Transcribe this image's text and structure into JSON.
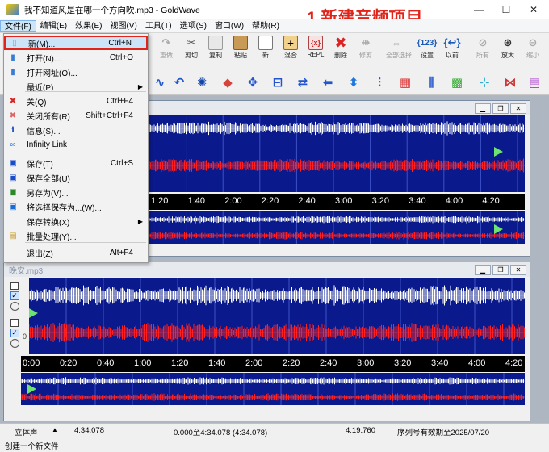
{
  "window": {
    "title": "我不知道风是在哪一个方向吹.mp3 - GoldWave"
  },
  "menu": [
    "文件(F)",
    "编辑(E)",
    "效果(E)",
    "视图(V)",
    "工具(T)",
    "选项(S)",
    "窗口(W)",
    "帮助(R)"
  ],
  "toolbar_labels": [
    "重做",
    "剪切",
    "复制",
    "粘贴",
    "新",
    "混合",
    "REPL",
    "删除",
    "修剪",
    "全部选择",
    "设置",
    "以前",
    "所有",
    "放大",
    "缩小"
  ],
  "file_menu": [
    {
      "icon": "new-file-icon",
      "label": "新(M)...",
      "shortcut": "Ctrl+N"
    },
    {
      "icon": "open-folder-icon",
      "label": "打开(N)...",
      "shortcut": "Ctrl+O"
    },
    {
      "icon": "open-url-icon",
      "label": "打开网址(O)...",
      "shortcut": ""
    },
    {
      "icon": "",
      "label": "最近(P)",
      "shortcut": ""
    },
    {
      "icon": "close-x-icon",
      "label": "关(Q)",
      "shortcut": "Ctrl+F4"
    },
    {
      "icon": "close-all-icon",
      "label": "关闭所有(R)",
      "shortcut": "Shift+Ctrl+F4"
    },
    {
      "icon": "info-icon",
      "label": "信息(S)...",
      "shortcut": ""
    },
    {
      "icon": "infinity-link-icon",
      "label": "Infinity Link",
      "shortcut": ""
    },
    {
      "icon": "save-icon",
      "label": "保存(T)",
      "shortcut": "Ctrl+S"
    },
    {
      "icon": "save-all-icon",
      "label": "保存全部(U)",
      "shortcut": ""
    },
    {
      "icon": "save-as-icon",
      "label": "另存为(V)...",
      "shortcut": ""
    },
    {
      "icon": "save-selection-icon",
      "label": "将选择保存为...(W)...",
      "shortcut": ""
    },
    {
      "icon": "",
      "label": "保存转换(X)",
      "shortcut": ""
    },
    {
      "icon": "batch-process-icon",
      "label": "批量处理(Y)...",
      "shortcut": ""
    },
    {
      "icon": "",
      "label": "退出(Z)",
      "shortcut": "Alt+F4"
    }
  ],
  "annotation": "1.新建音频项目",
  "wave1": {
    "title": "",
    "ticks": [
      "1:20",
      "1:40",
      "2:00",
      "2:20",
      "2:40",
      "3:00",
      "3:20",
      "3:40",
      "4:00",
      "4:20"
    ],
    "ch_label": "0"
  },
  "wave2": {
    "title": "晚安.mp3",
    "ticks": [
      "0:00",
      "0:20",
      "0:40",
      "1:00",
      "1:20",
      "1:40",
      "2:00",
      "2:20",
      "2:40",
      "3:00",
      "3:20",
      "3:40",
      "4:00",
      "4:20"
    ],
    "ch_label": "0"
  },
  "status": {
    "mode": "立体声",
    "length": "4:34.078",
    "range": "0.000至4:34.078  (4:34.078)",
    "pos": "4:19.760",
    "expire": "序列号有效期至2025/07/20",
    "message": "创建一个新文件"
  },
  "colors": {
    "wave_bg": "#0a1a8c",
    "left_channel": "#ffffff",
    "right_channel": "#ff2020",
    "accent": "#e2231a"
  }
}
